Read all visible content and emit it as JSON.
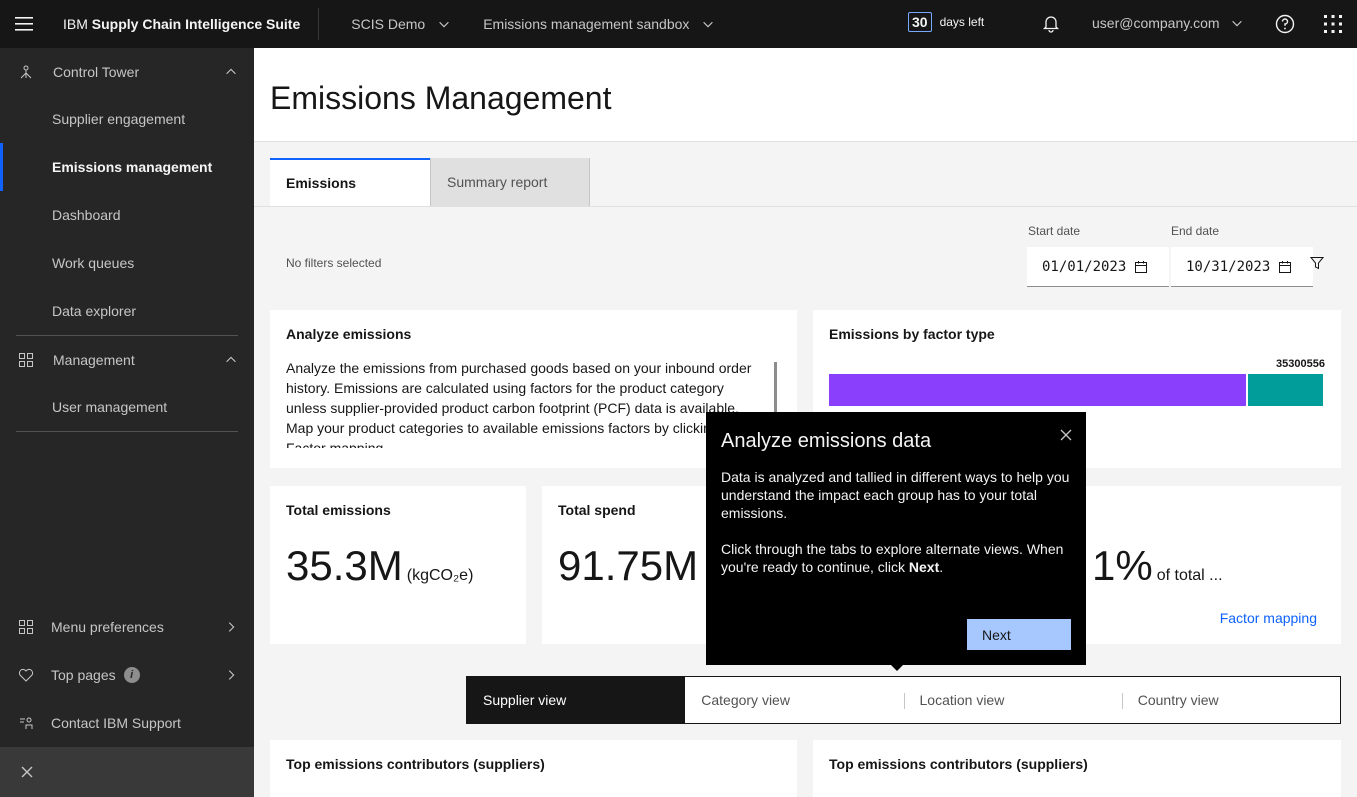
{
  "header": {
    "brand_prefix": "IBM",
    "brand_name": "Supply Chain Intelligence Suite",
    "tenant": "SCIS Demo",
    "workspace": "Emissions management sandbox",
    "days_count": "30",
    "days_text": "days left",
    "user": "user@company.com"
  },
  "sidebar": {
    "group1": "Control Tower",
    "items1": [
      "Supplier engagement",
      "Emissions management",
      "Dashboard",
      "Work queues",
      "Data explorer"
    ],
    "group2": "Management",
    "items2": [
      "User management"
    ],
    "bottom": [
      "Menu preferences",
      "Top pages",
      "Contact IBM Support"
    ]
  },
  "page": {
    "title": "Emissions Management",
    "tabs": [
      "Emissions",
      "Summary report"
    ],
    "no_filters": "No filters selected",
    "start_label": "Start date",
    "start_value": "01/01/2023",
    "end_label": "End date",
    "end_value": "10/31/2023"
  },
  "analyze": {
    "title": "Analyze emissions",
    "body": "Analyze the emissions from purchased goods based on your inbound order history. Emissions are calculated using factors for the product category unless supplier-provided product carbon footprint (PCF) data is available. Map your product categories to available emissions factors by clicking Factor mapping."
  },
  "factor_chart": {
    "title": "Emissions by factor type",
    "total_label": "35300556",
    "segments": [
      {
        "fraction": 0.845,
        "color": "#8a3ffc"
      },
      {
        "fraction": 0.155,
        "color": "#009d9a"
      }
    ]
  },
  "kpis": {
    "total_emissions_title": "Total emissions",
    "total_emissions_value": "35.3M",
    "total_emissions_unit": "(kgCO₂e)",
    "total_spend_title": "Total spend",
    "total_spend_value": "91.75M",
    "third_value": "1%",
    "third_suffix": "of total ...",
    "factor_mapping_link": "Factor mapping"
  },
  "views": [
    "Supplier view",
    "Category view",
    "Location view",
    "Country view"
  ],
  "bottom_cards": {
    "left_title": "Top emissions contributors (suppliers)",
    "right_title": "Top emissions contributors (suppliers)"
  },
  "tour": {
    "title": "Analyze emissions data",
    "p1": "Data is analyzed and tallied in different ways to help you understand the impact each group has to your total emissions.",
    "p2_prefix": "Click through the tabs to explore alternate views. When you're ready to continue, click ",
    "p2_bold": "Next",
    "p2_suffix": ".",
    "next_label": "Next"
  },
  "icons": {
    "menu": "hamburger-icon",
    "bell": "notification-icon",
    "help": "help-icon",
    "apps": "app-switcher-icon",
    "calendar": "calendar-icon",
    "filter": "filter-icon",
    "close": "close-icon"
  }
}
